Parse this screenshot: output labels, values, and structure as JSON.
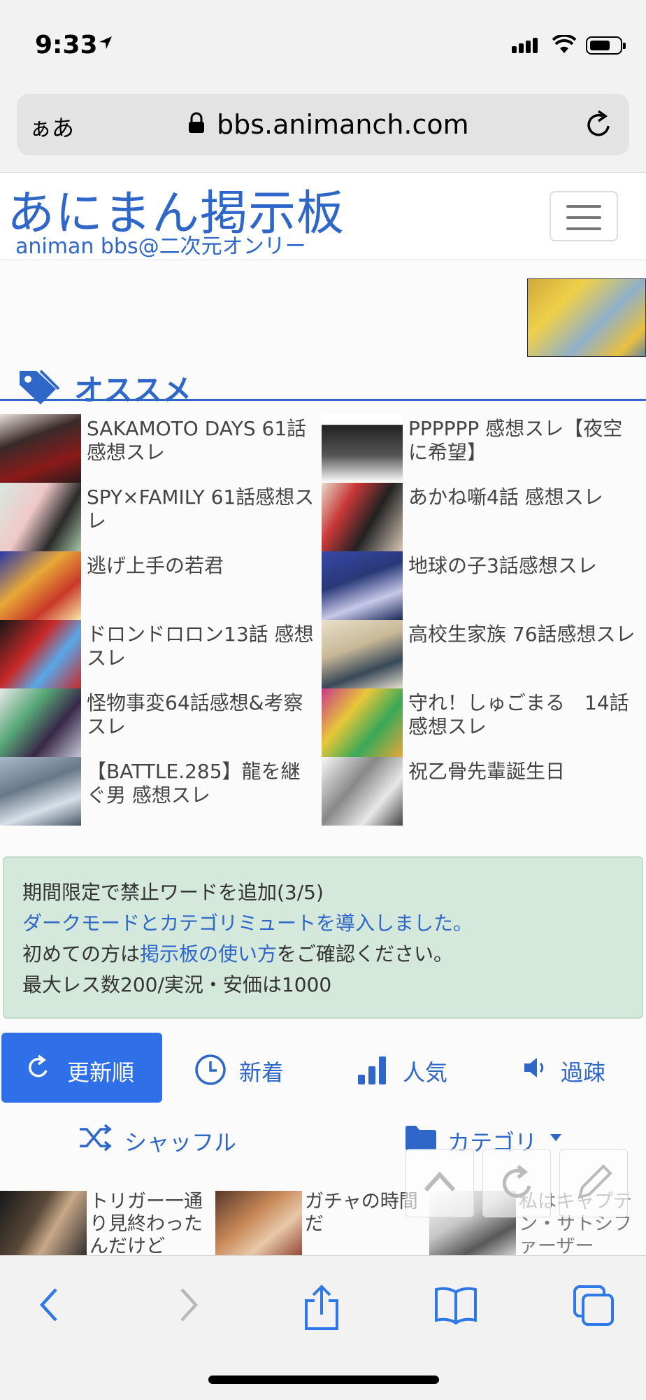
{
  "status_bar": {
    "time": "9:33"
  },
  "browser": {
    "text_size_label": "ぁあ",
    "url": "bbs.animanch.com"
  },
  "site": {
    "logo_title": "あにまん掲示板",
    "logo_subtitle": "animan bbs@二次元オンリー"
  },
  "recommend": {
    "heading": "オススメ",
    "items": [
      {
        "title": "SAKAMOTO DAYS 61話感想スレ"
      },
      {
        "title": "PPPPPP 感想スレ【夜空に希望】"
      },
      {
        "title": "SPY×FAMILY 61話感想スレ"
      },
      {
        "title": "あかね噺4話 感想スレ"
      },
      {
        "title": "逃げ上手の若君"
      },
      {
        "title": "地球の子3話感想スレ"
      },
      {
        "title": "ドロンドロロン13話 感想スレ"
      },
      {
        "title": "高校生家族 76話感想スレ"
      },
      {
        "title": "怪物事変64話感想&考察スレ"
      },
      {
        "title": "守れ！しゅごまる　14話感想スレ"
      },
      {
        "title": "【BATTLE.285】龍を継ぐ男 感想スレ"
      },
      {
        "title": "祝乙骨先輩誕生日"
      }
    ]
  },
  "notice": {
    "line1": "期間限定で禁止ワードを追加(3/5)",
    "line2": "ダークモードとカテゴリミュートを導入しました。",
    "line3_pre": "初めての方は",
    "line3_link": "掲示板の使い方",
    "line3_post": "をご確認ください。",
    "line4": "最大レス数200/実況・安価は1000"
  },
  "sort_tabs": {
    "updated": "更新順",
    "new": "新着",
    "popular": "人気",
    "old": "過疎",
    "shuffle": "シャッフル",
    "category": "カテゴリ"
  },
  "threads": [
    {
      "title": "トリガー一通り見終わったんだけど"
    },
    {
      "title": "ガチャの時間だ"
    },
    {
      "title": "私はキャプテン・サトシファーザー"
    }
  ],
  "colors": {
    "accent": "#2f67c8",
    "active_tab": "#2f6fe8",
    "notice_bg": "#d4e8dc"
  }
}
